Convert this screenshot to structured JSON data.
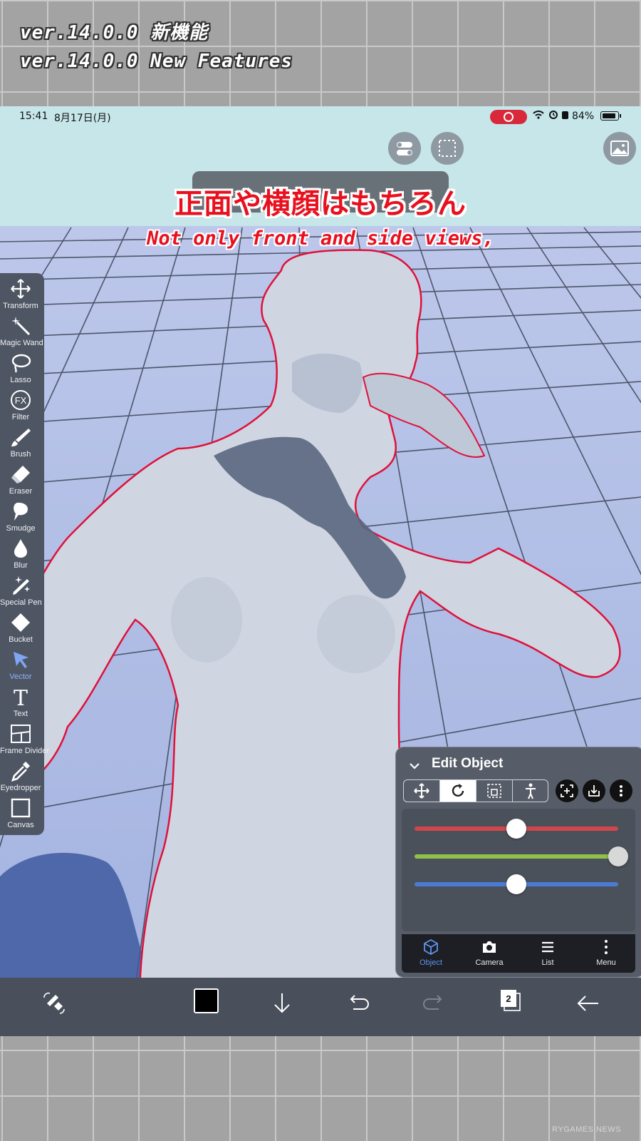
{
  "banner": {
    "line1": "ver.14.0.0 新機能",
    "line2": "ver.14.0.0 New Features"
  },
  "status_bar": {
    "time": "15:41",
    "date": "8月17日(月)",
    "battery": "84%",
    "icons": [
      "screen-record-icon",
      "wifi-icon",
      "alarm-icon",
      "lock-icon",
      "battery-icon"
    ]
  },
  "top_buttons": [
    "toggle-icon",
    "selection-icon",
    "image-icon"
  ],
  "subtitle": {
    "japanese": "正面や横顔はもちろん",
    "english": "Not only front and side views,"
  },
  "toolbar": {
    "tools": [
      {
        "label": "Transform",
        "icon": "transform-icon"
      },
      {
        "label": "Magic Wand",
        "icon": "magic-wand-icon"
      },
      {
        "label": "Lasso",
        "icon": "lasso-icon"
      },
      {
        "label": "Filter",
        "icon": "fx-icon"
      },
      {
        "label": "Brush",
        "icon": "brush-icon"
      },
      {
        "label": "Eraser",
        "icon": "eraser-icon"
      },
      {
        "label": "Smudge",
        "icon": "smudge-icon"
      },
      {
        "label": "Blur",
        "icon": "drop-icon"
      },
      {
        "label": "Special Pen",
        "icon": "sparkle-pen-icon"
      },
      {
        "label": "Bucket",
        "icon": "bucket-icon"
      },
      {
        "label": "Vector",
        "icon": "vector-arrow-icon",
        "active": true
      },
      {
        "label": "Text",
        "icon": "text-icon"
      },
      {
        "label": "Frame Divider",
        "icon": "frame-divider-icon"
      },
      {
        "label": "Eyedropper",
        "icon": "eyedropper-icon"
      },
      {
        "label": "Canvas",
        "icon": "canvas-icon"
      }
    ]
  },
  "edit_panel": {
    "title": "Edit Object",
    "modes": [
      "move-icon",
      "rotate-icon",
      "scale-icon",
      "pose-icon"
    ],
    "active_mode": "rotate-icon",
    "actions": [
      "fit-icon",
      "import-icon",
      "more-icon"
    ],
    "sliders": [
      {
        "axis": "x",
        "color": "#d0464b",
        "value": 0.5
      },
      {
        "axis": "y",
        "color": "#8fc04a",
        "value": 1.0
      },
      {
        "axis": "z",
        "color": "#4a7bd6",
        "value": 0.5
      }
    ],
    "tabs": [
      {
        "label": "Object",
        "icon": "cube-icon",
        "active": true
      },
      {
        "label": "Camera",
        "icon": "camera-icon"
      },
      {
        "label": "List",
        "icon": "list-icon"
      },
      {
        "label": "Menu",
        "icon": "kebab-icon"
      }
    ]
  },
  "bottom_bar": {
    "color": "#000000",
    "page_count": "2",
    "icons": [
      "swap-tools-icon",
      "color-swatch",
      "down-arrow-icon",
      "undo-icon",
      "redo-icon",
      "pages-icon",
      "back-arrow-icon"
    ]
  },
  "watermark": "RYGAMES NEWS"
}
